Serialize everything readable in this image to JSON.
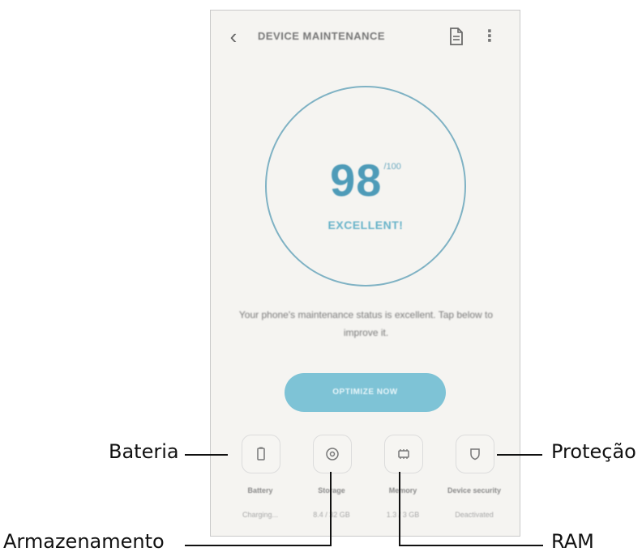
{
  "app": {
    "title": "DEVICE MAINTENANCE",
    "back_icon": "chevron-left-icon",
    "doc_icon": "document-icon",
    "more_icon": "more-vert-icon"
  },
  "score": {
    "value": "98",
    "max": "/100",
    "rating": "EXCELLENT!"
  },
  "status_text": "Your phone's maintenance status is excellent. Tap below to improve it.",
  "optimize_button": "OPTIMIZE NOW",
  "categories": [
    {
      "label": "Battery",
      "sub": "Charging...",
      "icon": "battery-icon"
    },
    {
      "label": "Storage",
      "sub": "8.4 / 32 GB",
      "icon": "storage-icon"
    },
    {
      "label": "Memory",
      "sub": "1.3 / 3 GB",
      "icon": "memory-icon"
    },
    {
      "label": "Device security",
      "sub": "Deactivated",
      "icon": "shield-icon"
    }
  ],
  "callouts": {
    "battery": "Bateria",
    "storage": "Armazenamento",
    "memory": "RAM",
    "security": "Proteção"
  },
  "colors": {
    "accent": "#7ec3d6",
    "ring": "#7fb2c4",
    "score": "#4e9bb8",
    "background": "#f5f4f1"
  }
}
